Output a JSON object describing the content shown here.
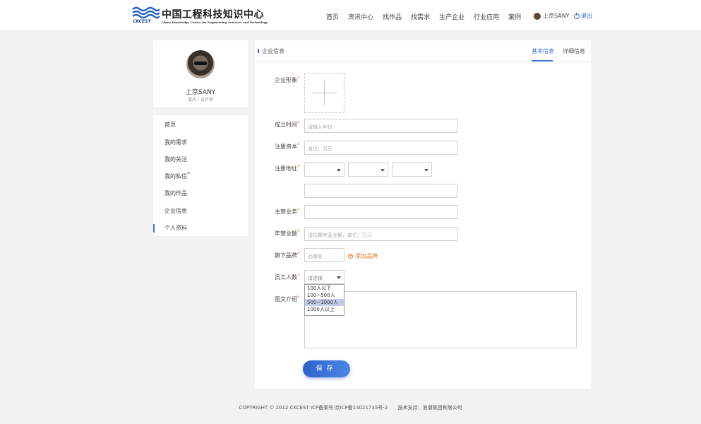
{
  "header": {
    "logo_cn": "中国工程科技知识中心",
    "logo_en": "China Knowledge Centre for Engineering Sciences and Technology",
    "logo_abbr": "CKCEST",
    "nav": [
      "首页",
      "资讯中心",
      "找作品",
      "找需求",
      "生产企业",
      "行业应用",
      "案例"
    ],
    "user_name": "上京SANY",
    "logout": "退出"
  },
  "profile": {
    "name": "上京SANY",
    "sub": "重庆 / 设计师"
  },
  "sidebar": {
    "items": [
      {
        "label": "首页"
      },
      {
        "label": "我的需求"
      },
      {
        "label": "我的关注"
      },
      {
        "label": "我的私信",
        "badge": "*"
      },
      {
        "label": "我的作品"
      },
      {
        "label": "企业信息"
      },
      {
        "label": "个人资料"
      }
    ],
    "active_index": 6
  },
  "panel": {
    "crumb": "企业信息",
    "tabs": [
      "基本信息",
      "详细信息"
    ],
    "active_tab": 0
  },
  "form": {
    "image_label": "企业形象",
    "founded_label": "成立时间",
    "founded_placeholder": "请输入年份",
    "capital_label": "注册资本",
    "capital_placeholder": "单位：万元",
    "address_label": "注册地址",
    "business_label": "主营业务",
    "revenue_label": "年营业额",
    "revenue_placeholder": "请估算年营业额，单位：万元",
    "brand_label": "旗下品牌",
    "brand_placeholder": "品牌名",
    "add_brand": "添加品牌",
    "staff_label": "员工人数",
    "staff_placeholder": "请选择",
    "staff_options": [
      "100人以下",
      "100~500人",
      "500~1000人",
      "1000人以上"
    ],
    "staff_highlight": 2,
    "intro_label": "图文介绍",
    "required_mark": "*",
    "save": "保存"
  },
  "footer": {
    "copyright": "COPYRIGHT © 2012 CKCEST ICP备案号:京ICP备14021735号-2",
    "support": "技术支持：浪潮集团有限公司"
  },
  "colors": {
    "accent": "#3a6fd8",
    "orange": "#e0781a",
    "badge": "#e02020"
  }
}
